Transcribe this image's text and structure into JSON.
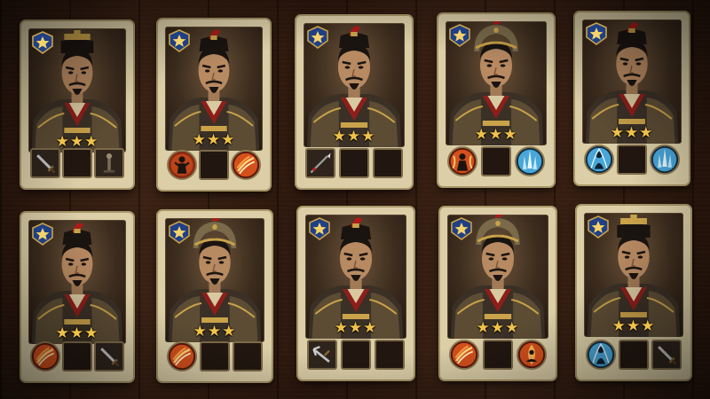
{
  "screen": "generals-roster",
  "colors": {
    "card_bg": "#dccfa8",
    "rank_badge": "#1f3f86",
    "star": "#f0c24a",
    "fire_skill": "#d4501c",
    "frost_skill": "#49a6d8",
    "empty_slot": "#221710"
  },
  "generals": [
    {
      "id": 1,
      "stars": 3,
      "max_stars": 3,
      "rank_icon": "rank-star-badge",
      "helmet": "crown-hat",
      "equipment": [
        {
          "type": "weapon",
          "icon": "sword-icon"
        },
        {
          "type": "empty",
          "icon": ""
        },
        {
          "type": "armor",
          "icon": "totem-icon"
        }
      ]
    },
    {
      "id": 2,
      "stars": 3,
      "max_stars": 3,
      "rank_icon": "rank-star-badge",
      "helmet": "plume-hat",
      "equipment": [
        {
          "type": "skill",
          "icon": "warrior-skill-icon"
        },
        {
          "type": "empty",
          "icon": ""
        },
        {
          "type": "skill",
          "icon": "fire-strike-icon"
        }
      ]
    },
    {
      "id": 3,
      "stars": 3,
      "max_stars": 3,
      "rank_icon": "rank-star-badge",
      "helmet": "plume-hat",
      "equipment": [
        {
          "type": "weapon",
          "icon": "spear-icon"
        },
        {
          "type": "empty",
          "icon": ""
        },
        {
          "type": "empty",
          "icon": ""
        }
      ]
    },
    {
      "id": 4,
      "stars": 3,
      "max_stars": 3,
      "rank_icon": "rank-star-badge",
      "helmet": "war-helmet",
      "equipment": [
        {
          "type": "skill",
          "icon": "flame-warrior-icon"
        },
        {
          "type": "empty",
          "icon": ""
        },
        {
          "type": "skill",
          "icon": "ice-spike-icon"
        }
      ]
    },
    {
      "id": 5,
      "stars": 3,
      "max_stars": 3,
      "rank_icon": "rank-star-badge",
      "helmet": "plume-hat",
      "equipment": [
        {
          "type": "skill",
          "icon": "frost-figure-icon"
        },
        {
          "type": "empty",
          "icon": ""
        },
        {
          "type": "skill",
          "icon": "ice-spike-icon"
        }
      ]
    },
    {
      "id": 6,
      "stars": 3,
      "max_stars": 3,
      "rank_icon": "rank-star-badge",
      "helmet": "plume-hat",
      "equipment": [
        {
          "type": "skill",
          "icon": "fire-slash-icon"
        },
        {
          "type": "empty",
          "icon": ""
        },
        {
          "type": "weapon",
          "icon": "sword-icon"
        }
      ]
    },
    {
      "id": 7,
      "stars": 3,
      "max_stars": 3,
      "rank_icon": "rank-star-badge",
      "helmet": "war-helmet",
      "equipment": [
        {
          "type": "skill",
          "icon": "fire-slash-icon"
        },
        {
          "type": "empty",
          "icon": ""
        },
        {
          "type": "empty",
          "icon": ""
        }
      ]
    },
    {
      "id": 8,
      "stars": 3,
      "max_stars": 3,
      "rank_icon": "rank-star-badge",
      "helmet": "plume-hat",
      "equipment": [
        {
          "type": "weapon",
          "icon": "crossbow-icon"
        },
        {
          "type": "empty",
          "icon": ""
        },
        {
          "type": "empty",
          "icon": ""
        }
      ]
    },
    {
      "id": 9,
      "stars": 3,
      "max_stars": 3,
      "rank_icon": "rank-star-badge",
      "helmet": "war-helmet",
      "equipment": [
        {
          "type": "skill",
          "icon": "fire-slash-icon"
        },
        {
          "type": "empty",
          "icon": ""
        },
        {
          "type": "skill",
          "icon": "meditation-fire-icon"
        }
      ]
    },
    {
      "id": 10,
      "stars": 3,
      "max_stars": 3,
      "rank_icon": "rank-star-badge",
      "helmet": "crown-hat",
      "equipment": [
        {
          "type": "skill",
          "icon": "frost-figure-icon"
        },
        {
          "type": "empty",
          "icon": ""
        },
        {
          "type": "weapon",
          "icon": "sword-icon"
        }
      ]
    }
  ]
}
